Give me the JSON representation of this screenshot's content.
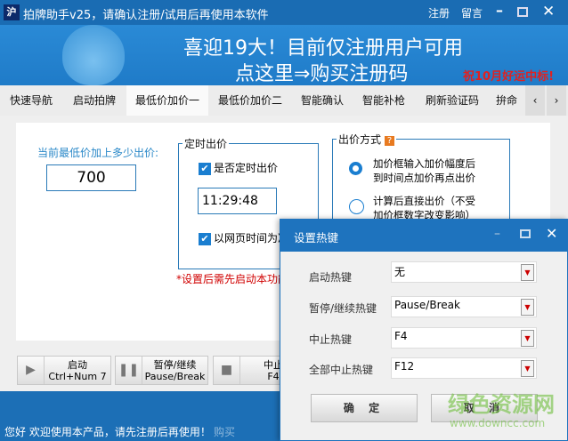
{
  "window": {
    "icon": "沪",
    "title": "拍牌助手v25，请确认注册/试用后再使用本软件",
    "register": "注册",
    "message": "留言"
  },
  "banner": {
    "line1": "喜迎19大！目前仅注册用户可用",
    "line2": "点这里⇒购买注册码",
    "wish": "祝10月好运中标!"
  },
  "tabs": [
    {
      "label": "快速导航"
    },
    {
      "label": "启动拍牌"
    },
    {
      "label": "最低价加价一",
      "active": true
    },
    {
      "label": "最低价加价二"
    },
    {
      "label": "智能确认"
    },
    {
      "label": "智能补枪"
    },
    {
      "label": "刷新验证码"
    },
    {
      "label": "拚命"
    }
  ],
  "main": {
    "price_label": "当前最低价加上多少出价:",
    "price_value": "700",
    "timed": {
      "legend": "定时出价",
      "enable_label": "是否定时出价",
      "enabled": true,
      "time": "11:29:48",
      "webtime_label": "以网页时间为准",
      "webtime": true
    },
    "note": "*设置后需先启动本功能",
    "mode": {
      "legend": "出价方式",
      "help_icon": "?",
      "options": [
        {
          "label": "加价框输入加价幅度后到时间点加价再点出价",
          "selected": true
        },
        {
          "label": "计算后直接出价（不受加价框数字改变影响）",
          "selected": false
        }
      ]
    }
  },
  "buttons": [
    {
      "icon": "play-icon",
      "label": "启动",
      "hotkey": "Ctrl+Num 7"
    },
    {
      "icon": "pause-icon",
      "label": "暂停/继续",
      "hotkey": "Pause/Break"
    },
    {
      "icon": "stop-icon",
      "label": "中止",
      "hotkey": "F4"
    }
  ],
  "status": {
    "text": "您好 欢迎使用本产品，请先注册后再使用！",
    "buy": "购买"
  },
  "dialog": {
    "title": "设置热键",
    "rows": [
      {
        "label": "启动热键",
        "value": "无"
      },
      {
        "label": "暂停/继续热键",
        "value": "Pause/Break"
      },
      {
        "label": "中止热键",
        "value": "F4"
      },
      {
        "label": "全部中止热键",
        "value": "F12"
      }
    ],
    "ok": "确 定",
    "cancel": "取 消"
  },
  "watermark": {
    "name": "绿色资源网",
    "url": "www.downcc.com"
  },
  "colors": {
    "titlebar": "#1a6cb3",
    "accent": "#1e73be",
    "note": "#d00000"
  }
}
